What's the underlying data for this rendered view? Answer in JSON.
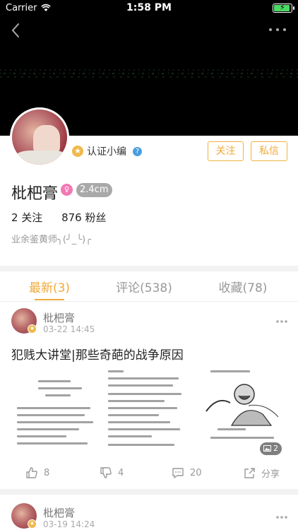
{
  "status_bar": {
    "carrier": "Carrier",
    "time": "1:58 PM",
    "bolt": "⚡"
  },
  "profile": {
    "verify_badge": "★",
    "verify_label": "认证小编",
    "verify_help": "?",
    "follow_label": "关注",
    "message_label": "私信",
    "name": "枇杷膏",
    "gender_symbol": "♀",
    "size_badge": "2.4cm",
    "following": "2 关注",
    "followers": "876 粉丝",
    "bio": "业余鉴黄师╮(╯_╰)╭"
  },
  "tabs": [
    {
      "label": "最新(3)",
      "active": true
    },
    {
      "label": "评论(538)",
      "active": false
    },
    {
      "label": "收藏(78)",
      "active": false
    }
  ],
  "posts": [
    {
      "author": "枇杷膏",
      "time": "03-22 14:45",
      "title": "犯贱大讲堂|那些奇葩的战争原因",
      "image_count": "2",
      "likes": "8",
      "dislikes": "4",
      "comments": "20",
      "share_label": "分享"
    },
    {
      "author": "枇杷膏",
      "time": "03-19 14:24"
    }
  ],
  "colors": {
    "accent": "#f0a93a",
    "verify": "#f0b94a",
    "help": "#4a9ee0",
    "gender": "#f279b4",
    "battery": "#4cd964"
  }
}
